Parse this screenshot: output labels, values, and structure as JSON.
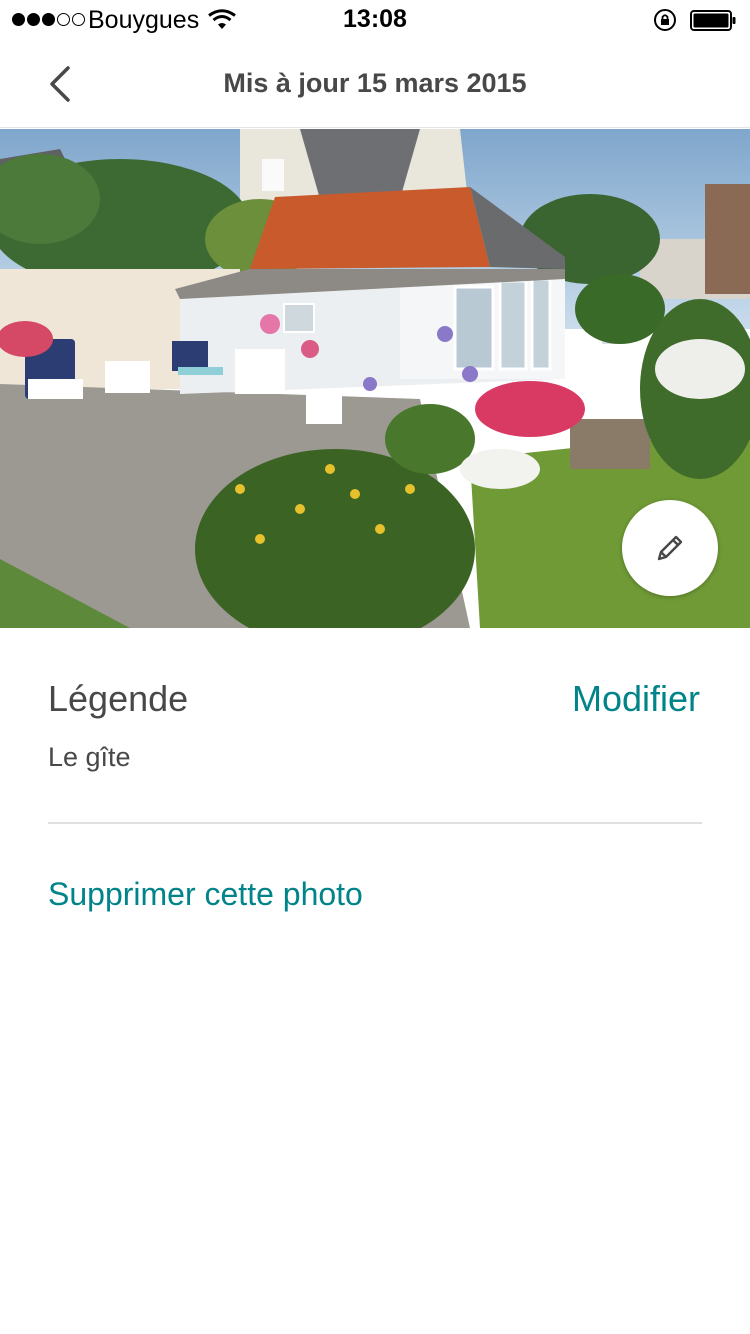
{
  "status_bar": {
    "carrier": "Bouygues",
    "time": "13:08",
    "signal_bars_filled": 3,
    "signal_bars_total": 5
  },
  "nav": {
    "title": "Mis à jour 15 mars 2015",
    "back_icon": "chevron-left-icon"
  },
  "photo": {
    "description_icon": "photo-garden-house",
    "edit_icon": "pencil-icon"
  },
  "caption": {
    "label": "Légende",
    "edit_label": "Modifier",
    "value": "Le gîte"
  },
  "actions": {
    "delete_label": "Supprimer cette photo"
  },
  "colors": {
    "accent": "#008489",
    "text": "#484848",
    "divider": "#e0e0e0"
  }
}
